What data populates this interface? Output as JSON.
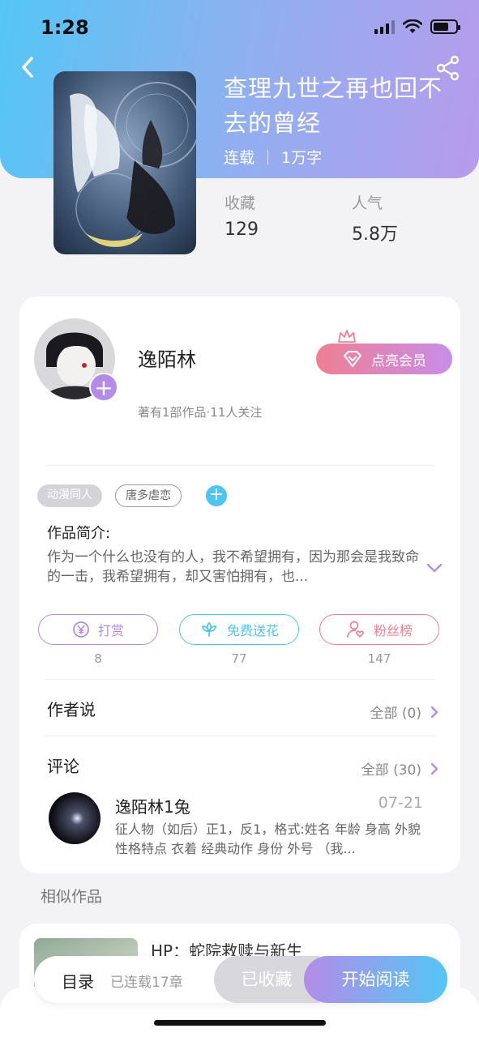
{
  "status_bar": {
    "time": "1:28",
    "battery_level": 0.7
  },
  "book": {
    "title": "查理九世之再也回不去的曾经",
    "status": "连载",
    "word_count": "1万字",
    "stats": [
      {
        "label": "收藏",
        "value": "129"
      },
      {
        "label": "人气",
        "value": "5.8万"
      }
    ]
  },
  "author": {
    "name": "逸陌林",
    "meta": "著有1部作品·11人关注",
    "vip_label": "点亮会员",
    "follow_symbol": "+"
  },
  "tags": [
    "动漫同人",
    "唐多虐恋"
  ],
  "tag_add_symbol": "+",
  "intro": {
    "title": "作品简介:",
    "text": "作为一个什么也没有的人，我不希望拥有，因为那会是我致命的一击，我希望拥有，却又害怕拥有，也..."
  },
  "actions": [
    {
      "label": "打赏",
      "count": "8",
      "color": "#b48ce8",
      "icon": "yen-coin-icon"
    },
    {
      "label": "免费送花",
      "count": "77",
      "color": "#4dc4f2",
      "icon": "flower-icon"
    },
    {
      "label": "粉丝榜",
      "count": "147",
      "color": "#ef7f93",
      "icon": "fan-user-icon"
    }
  ],
  "author_says": {
    "title": "作者说",
    "link": "全部 (0)"
  },
  "comments": {
    "title": "评论",
    "link": "全部 (30)",
    "items": [
      {
        "user": "逸陌林1兔",
        "date": "07-21",
        "text": "征人物（如后）正1，反1，格式:姓名 年龄 身高 外貌 性格特点 衣着 经典动作 身份 外号 （我..."
      }
    ]
  },
  "similar": {
    "title": "相似作品",
    "items": [
      {
        "name": "HP：蛇院救赎与新生"
      }
    ]
  },
  "bottom_bar": {
    "toc_label": "目录",
    "chapters": "已连载17章",
    "favorited_label": "已收藏",
    "read_label": "开始阅读"
  }
}
